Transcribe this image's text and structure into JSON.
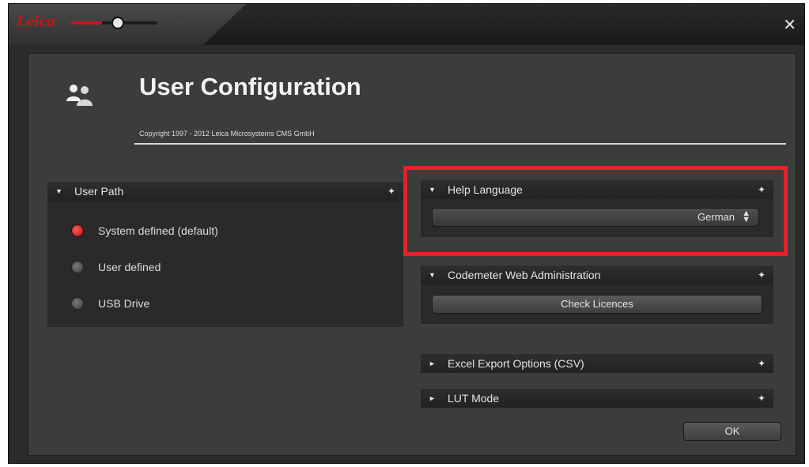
{
  "titlebar": {
    "logo_text": "Leica",
    "close_label": "✕",
    "accent_color": "#c0171c"
  },
  "header": {
    "title": "User Configuration",
    "copyright": "Copyright 1997 - 2012 Leica Microsystems CMS GmbH",
    "icon": "users-icon"
  },
  "user_path": {
    "label": "User Path",
    "options": [
      {
        "label": "System defined (default)",
        "checked": true
      },
      {
        "label": "User defined",
        "checked": false
      },
      {
        "label": "USB Drive",
        "checked": false
      }
    ]
  },
  "help_language": {
    "label": "Help Language",
    "selected": "German"
  },
  "codemeter": {
    "label": "Codemeter Web Administration",
    "button_label": "Check Licences"
  },
  "excel_export": {
    "label": "Excel Export Options (CSV)"
  },
  "lut_mode": {
    "label": "LUT Mode"
  },
  "ok_label": "OK",
  "highlight_color": "#e0222b"
}
